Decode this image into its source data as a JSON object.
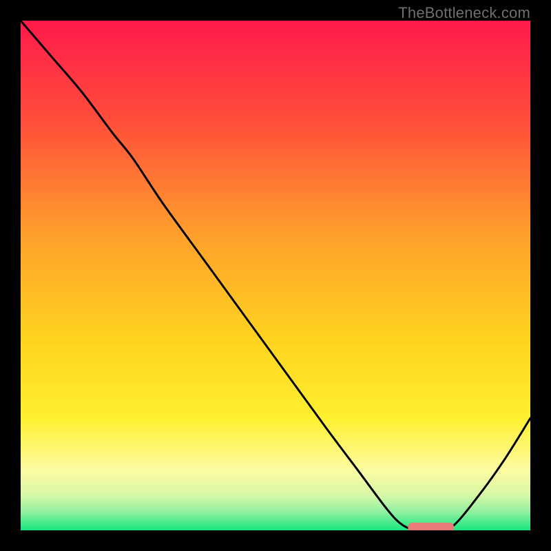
{
  "watermark": "TheBottleneck.com",
  "chart_data": {
    "type": "line",
    "title": "",
    "xlabel": "",
    "ylabel": "",
    "xlim": [
      0,
      100
    ],
    "ylim": [
      0,
      100
    ],
    "gradient_stops": [
      {
        "offset": 0.0,
        "color": "#ff1a4b"
      },
      {
        "offset": 0.2,
        "color": "#ff4f3a"
      },
      {
        "offset": 0.42,
        "color": "#ffa02c"
      },
      {
        "offset": 0.62,
        "color": "#ffd21f"
      },
      {
        "offset": 0.78,
        "color": "#fff030"
      },
      {
        "offset": 0.88,
        "color": "#fdfca0"
      },
      {
        "offset": 0.93,
        "color": "#d9f8a8"
      },
      {
        "offset": 0.965,
        "color": "#8ef0a0"
      },
      {
        "offset": 1.0,
        "color": "#17e67f"
      }
    ],
    "series": [
      {
        "name": "bottleneck-curve",
        "x": [
          0,
          6,
          12,
          18,
          22,
          28,
          36,
          44,
          52,
          60,
          66,
          72,
          75,
          78,
          82,
          85,
          90,
          95,
          100
        ],
        "y": [
          100,
          93,
          86,
          78,
          73,
          64,
          53,
          42,
          31,
          20,
          12,
          4,
          1,
          0,
          0,
          1,
          7,
          14,
          22
        ]
      }
    ],
    "marker": {
      "name": "optimal-band",
      "x_start": 76,
      "x_end": 85,
      "y": 0.4,
      "color": "#e87b78",
      "thickness": 2.2
    }
  }
}
